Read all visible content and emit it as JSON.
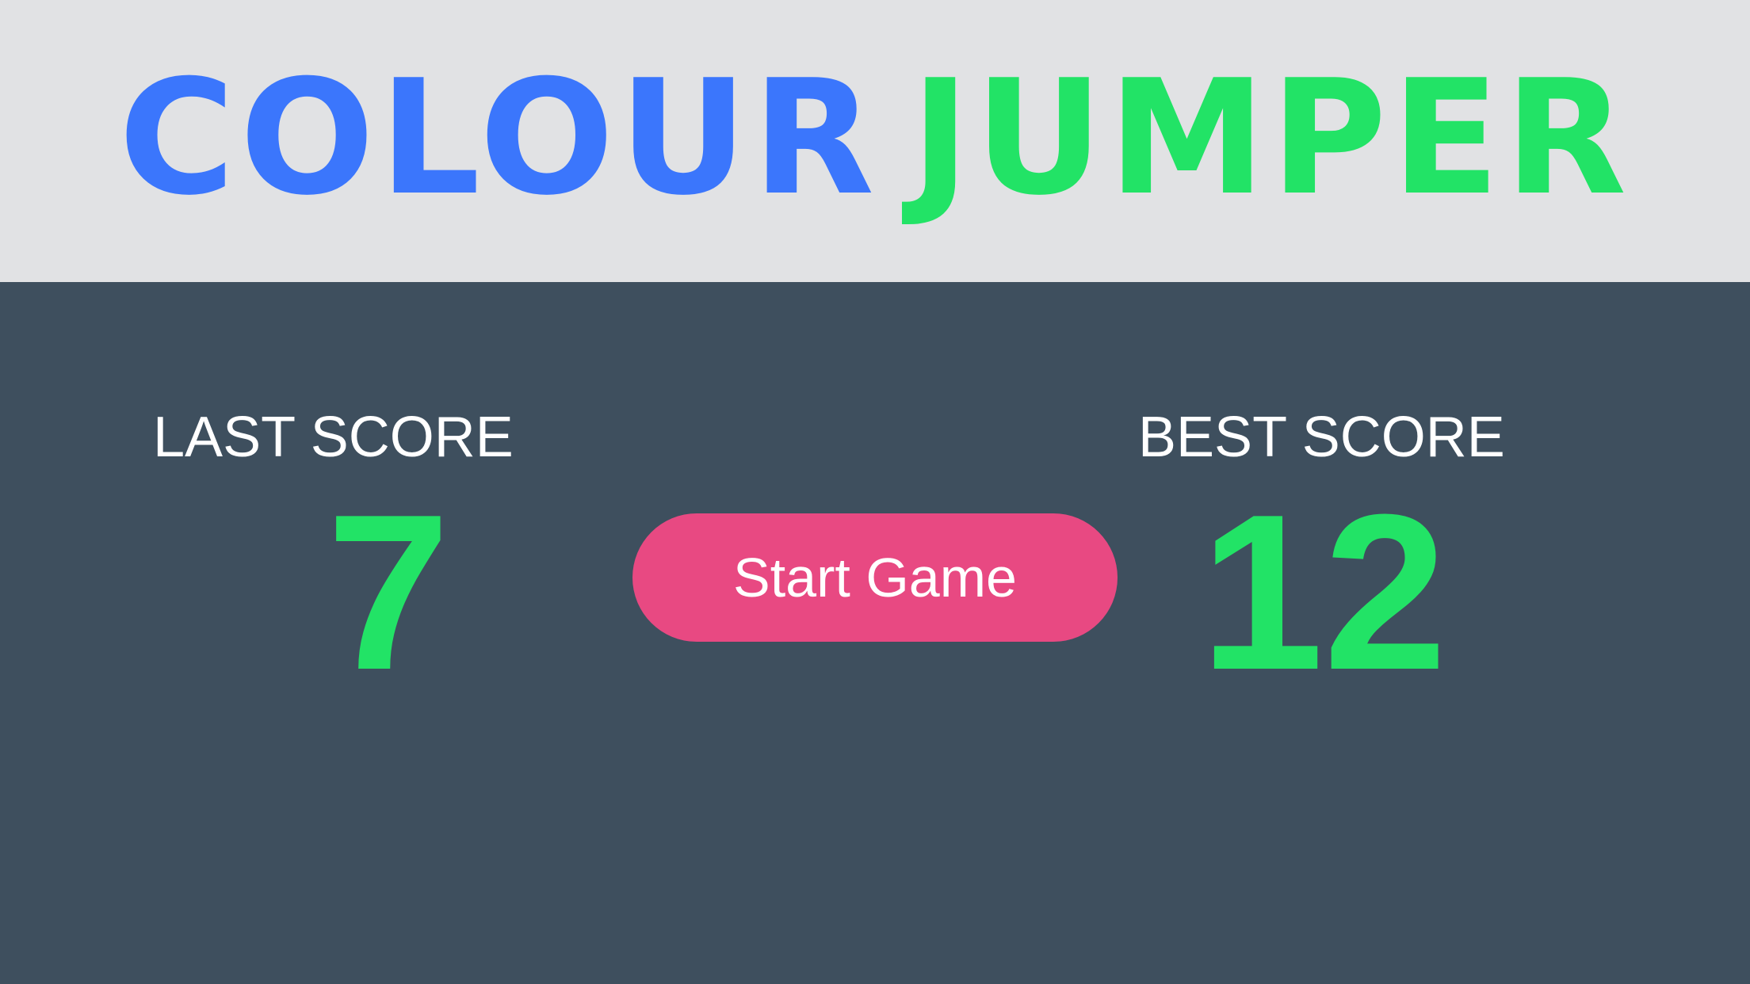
{
  "title": {
    "word1": "COLOUR",
    "word2": "JUMPER"
  },
  "scores": {
    "last_label": "LAST SCORE",
    "last_value": "7",
    "best_label": "BEST SCORE",
    "best_value": "12"
  },
  "start_button": {
    "label": "Start Game"
  },
  "colors": {
    "title_blue": "#3b76fc",
    "accent_green": "#22e366",
    "button_pink": "#e84982",
    "background": "#3e4f5e",
    "header_background": "#e1e2e4"
  }
}
